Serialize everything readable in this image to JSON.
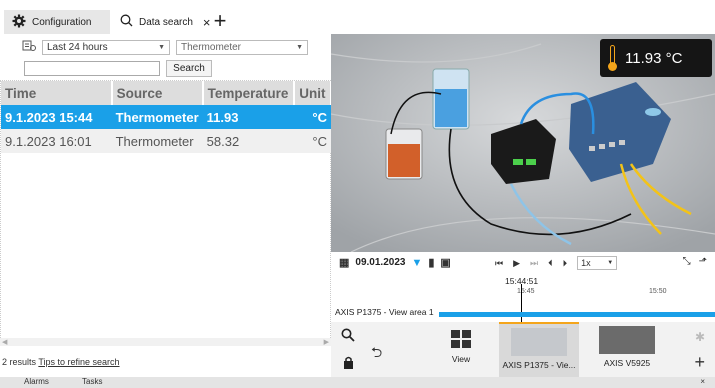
{
  "tabs": {
    "config_label": "Configuration",
    "search_label": "Data search",
    "close_glyph": "×",
    "add_glyph": "+"
  },
  "search": {
    "range_value": "Last 24 hours",
    "source_value": "Thermometer",
    "text_value": "",
    "button_label": "Search"
  },
  "table": {
    "headers": [
      "Time",
      "Source",
      "Temperature",
      "Unit"
    ],
    "rows": [
      [
        "9.1.2023 15:44",
        "Thermometer",
        "11.93",
        "°C"
      ],
      [
        "9.1.2023 16:01",
        "Thermometer",
        "58.32",
        "°C"
      ]
    ]
  },
  "footer": {
    "results": "2 results",
    "tips_link": "Tips to refine search"
  },
  "video": {
    "temp_overlay": "11.93 °C"
  },
  "timeline": {
    "date": "09.01.2023",
    "speed": "1x",
    "current_time": "15:44:51",
    "tick_a": "15:45",
    "tick_b": "15:50",
    "track_label": "AXIS P1375 - View area 1"
  },
  "bottombar": {
    "view_label": "View",
    "cam1_label": "AXIS P1375 - Vie...",
    "cam2_label": "AXIS V5925"
  },
  "bottomtabs": {
    "alarms": "Alarms",
    "tasks": "Tasks",
    "close_glyph": "×"
  },
  "colors": {
    "accent": "#1aa0e8",
    "highlight": "#f4a51b"
  }
}
